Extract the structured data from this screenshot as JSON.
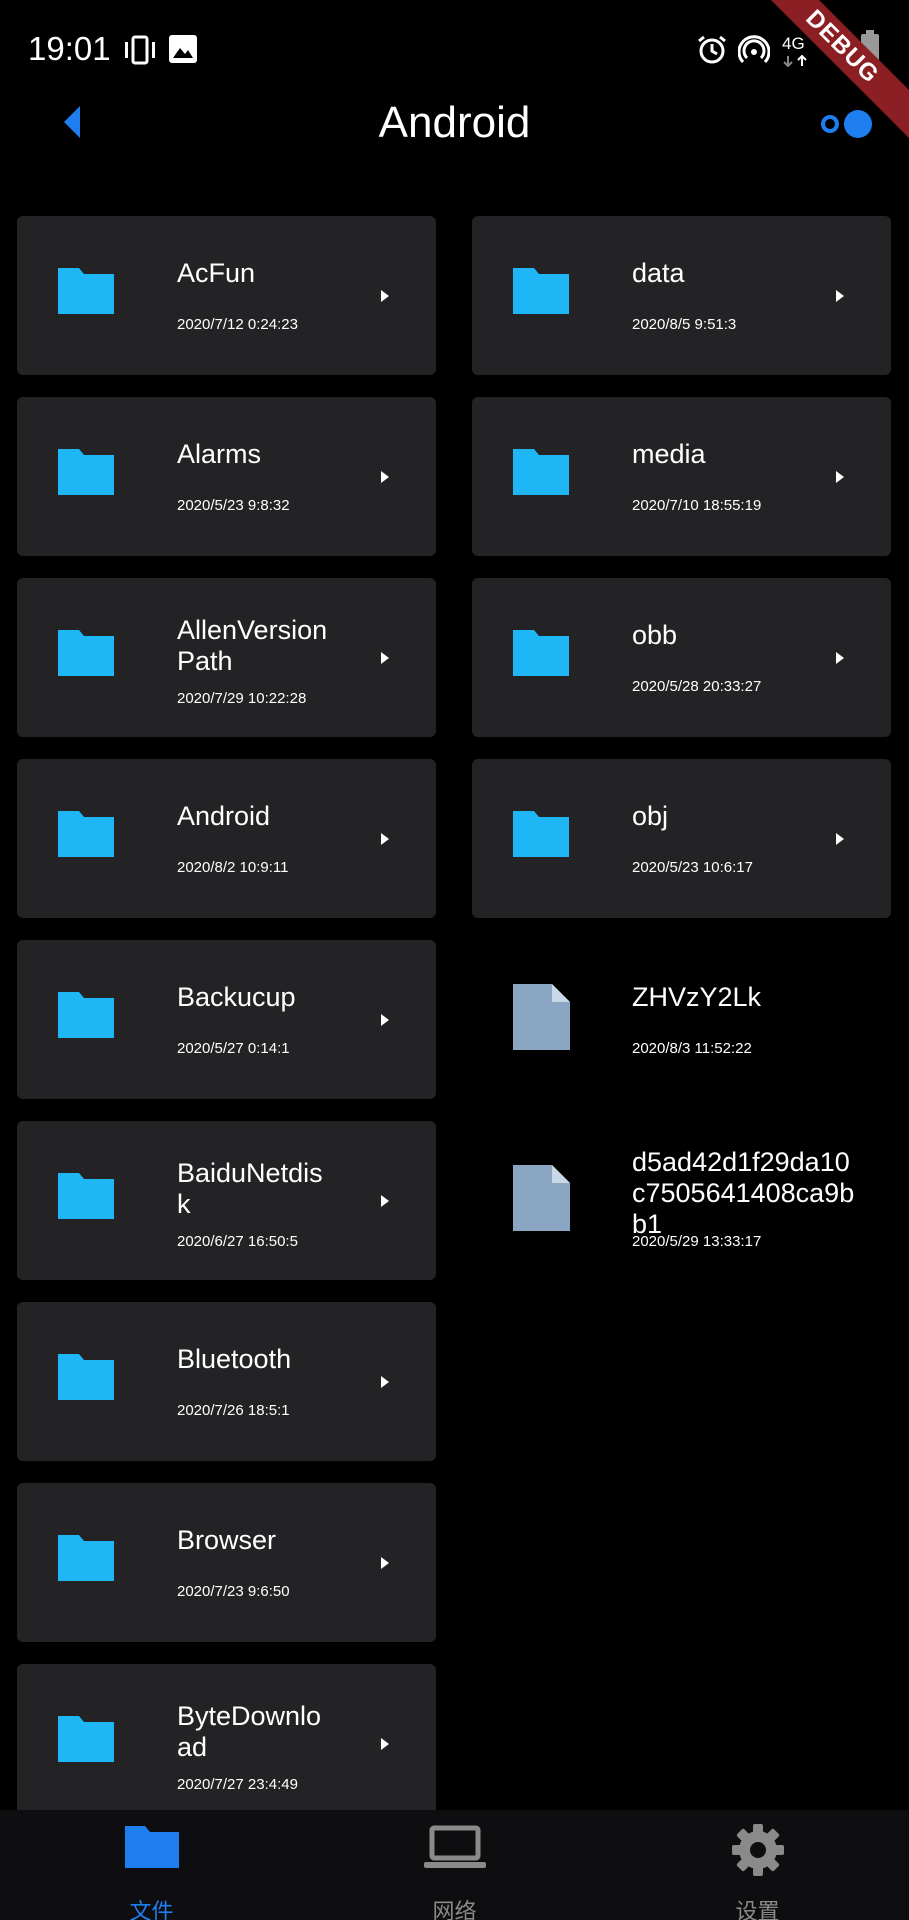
{
  "status_bar": {
    "time": "19:01",
    "network": "4G",
    "debug_label": "DEBUG"
  },
  "app_bar": {
    "title": "Android"
  },
  "colors": {
    "folder": "#1fb6f5",
    "file": "#8aa6c2",
    "accent": "#1e7ef0",
    "card": "#232325"
  },
  "left_column": [
    {
      "name": "AcFun",
      "date": "2020/7/12 0:24:23"
    },
    {
      "name": "Alarms",
      "date": "2020/5/23 9:8:32"
    },
    {
      "name": "AllenVersionPath",
      "date": "2020/7/29 10:22:28"
    },
    {
      "name": "Android",
      "date": "2020/8/2 10:9:11"
    },
    {
      "name": "Backucup",
      "date": "2020/5/27 0:14:1"
    },
    {
      "name": "BaiduNetdisk",
      "date": "2020/6/27 16:50:5"
    },
    {
      "name": "Bluetooth",
      "date": "2020/7/26 18:5:1"
    },
    {
      "name": "Browser",
      "date": "2020/7/23 9:6:50"
    },
    {
      "name": "ByteDownload",
      "date": "2020/7/27 23:4:49"
    }
  ],
  "right_column": [
    {
      "name": "data",
      "date": "2020/8/5 9:51:3"
    },
    {
      "name": "media",
      "date": "2020/7/10 18:55:19"
    },
    {
      "name": "obb",
      "date": "2020/5/28 20:33:27"
    },
    {
      "name": "obj",
      "date": "2020/5/23 10:6:17"
    },
    {
      "name": "ZHVzY2Lk",
      "date": "2020/8/3 11:52:22"
    },
    {
      "name": "d5ad42d1f29da10c7505641408ca9bb1",
      "date": "2020/5/29 13:33:17"
    }
  ],
  "bottom_nav": [
    {
      "label": "文件",
      "icon": "folder-icon",
      "active": true
    },
    {
      "label": "网络",
      "icon": "laptop-icon",
      "active": false
    },
    {
      "label": "设置",
      "icon": "gear-icon",
      "active": false
    }
  ]
}
